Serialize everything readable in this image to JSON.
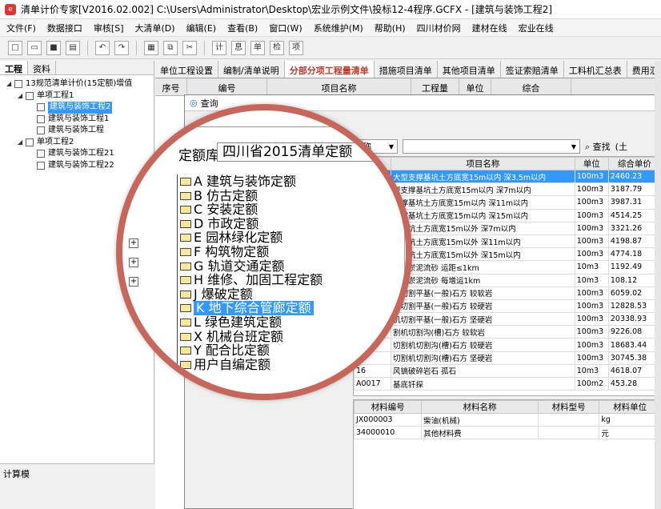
{
  "window": {
    "title": "清单计价专家[V2016.02.002] C:\\Users\\Administrator\\Desktop\\宏业示例文件\\投标12-4程序.GCFX - [建筑与装饰工程2]"
  },
  "menu": [
    "文件(F)",
    "数据接口",
    "审核[S]",
    "大清单(D)",
    "编辑(E)",
    "查看(B)",
    "窗口(W)",
    "系统维护(M)",
    "帮助(H)",
    "四川材价网",
    "建材在线",
    "宏业在线"
  ],
  "left_panel": {
    "tabs": [
      "工程",
      "资料"
    ],
    "tree": [
      {
        "label": "13规范清单计价(15定额)增值",
        "level": 0
      },
      {
        "label": "单项工程1",
        "level": 1
      },
      {
        "label": "建筑与装饰工程2",
        "level": 2,
        "selected": true
      },
      {
        "label": "建筑与装饰工程1",
        "level": 2
      },
      {
        "label": "建筑与装饰工程",
        "level": 2
      },
      {
        "label": "单项工程2",
        "level": 1
      },
      {
        "label": "建筑与装饰工程21",
        "level": 2
      },
      {
        "label": "建筑与装饰工程22",
        "level": 2
      }
    ],
    "bottom_label": "计算模"
  },
  "main_tabs": [
    "单位工程设置",
    "编制/清单说明",
    "分部分项工程量清单",
    "措施项目清单",
    "其他项目清单",
    "签证索赔清单",
    "工料机汇总表",
    "费用汇"
  ],
  "grid_header": [
    "序号",
    "编号",
    "项目名称",
    "工程量",
    "单位",
    "综合"
  ],
  "dialog": {
    "title": "查询",
    "search_field": "名称",
    "find_label": "查找",
    "extra_label": "(土",
    "results_headers": [
      "号",
      "项目名称",
      "单位",
      "综合单价"
    ],
    "results": [
      {
        "code": "",
        "name": "大型支撑基坑土方底宽15m以内 深3.5m以内",
        "unit": "100m3",
        "price": "2460.23",
        "selected": true
      },
      {
        "code": "",
        "name": "型支撑基坑土方底宽15m以内 深7m以内",
        "unit": "100m3",
        "price": "3187.79"
      },
      {
        "code": "",
        "name": "支撑基坑土方底宽15m以内 深11m以内",
        "unit": "100m3",
        "price": "3987.31"
      },
      {
        "code": "",
        "name": "支撑基坑土方底宽15m以内 深15m以内",
        "unit": "100m3",
        "price": "4514.25"
      },
      {
        "code": "",
        "name": "撑基坑土方底宽15m以外 深7m以内",
        "unit": "100m3",
        "price": "3321.26"
      },
      {
        "code": "",
        "name": "撑基坑土方底宽15m以外 深11m以内",
        "unit": "100m3",
        "price": "4198.87"
      },
      {
        "code": "",
        "name": "撑基坑土方底宽15m以外 深15m以内",
        "unit": "100m3",
        "price": "4774.18"
      },
      {
        "code": "",
        "name": "车运淤泥流砂 运距≤1km",
        "unit": "10m3",
        "price": "1192.49"
      },
      {
        "code": "",
        "name": "车运淤泥流砂 每增运1km",
        "unit": "10m3",
        "price": "108.12"
      },
      {
        "code": "",
        "name": "机切割平基(一般)石方 较软岩",
        "unit": "100m3",
        "price": "6059.02"
      },
      {
        "code": "",
        "name": "机切割平基(一般)石方 较硬岩",
        "unit": "100m3",
        "price": "12828.53"
      },
      {
        "code": "",
        "name": "机切割平基(一般)石方 坚硬岩",
        "unit": "100m3",
        "price": "20338.93"
      },
      {
        "code": "",
        "name": "割机切割沟(槽)石方 较软岩",
        "unit": "100m3",
        "price": "9226.08"
      },
      {
        "code": "",
        "name": "切割机切割沟(槽)石方 较硬岩",
        "unit": "100m3",
        "price": "18683.44"
      },
      {
        "code": "",
        "name": "切割机切割沟(槽)石方 坚硬岩",
        "unit": "100m3",
        "price": "30745.38"
      },
      {
        "code": "16",
        "name": "风镐破碎岩石 孤石",
        "unit": "10m3",
        "price": "4618.07"
      },
      {
        "code": "A0017",
        "name": "基底钎探",
        "unit": "100m2",
        "price": "453.28"
      }
    ],
    "materials_headers": [
      "材料编号",
      "材料名称",
      "材料型号",
      "材料单位"
    ],
    "materials": [
      {
        "code": "JX000003",
        "name": "柴油(机械)",
        "model": "",
        "unit": "kg"
      },
      {
        "code": "34000010",
        "name": "其他材料费",
        "model": "",
        "unit": "元"
      }
    ]
  },
  "magnifier": {
    "library_label": "定额库",
    "library_value": "四川省2015清单定额",
    "items": [
      "A 建筑与装饰定额",
      "B 仿古定额",
      "C 安装定额",
      "D 市政定额",
      "E 园林绿化定额",
      "F 构筑物定额",
      "G 轨道交通定额",
      "H 维修、加固工程定额",
      "J 爆破定额",
      "K 地下综合管廊定额",
      "L 绿色建筑定额",
      "X 机械台班定额",
      "Y 配合比定额",
      "用户自编定额"
    ],
    "selected_index": 9,
    "ring_color": "#c7665a"
  },
  "colors": {
    "selection": "#3399ff",
    "active_tab": "#c0392b"
  }
}
